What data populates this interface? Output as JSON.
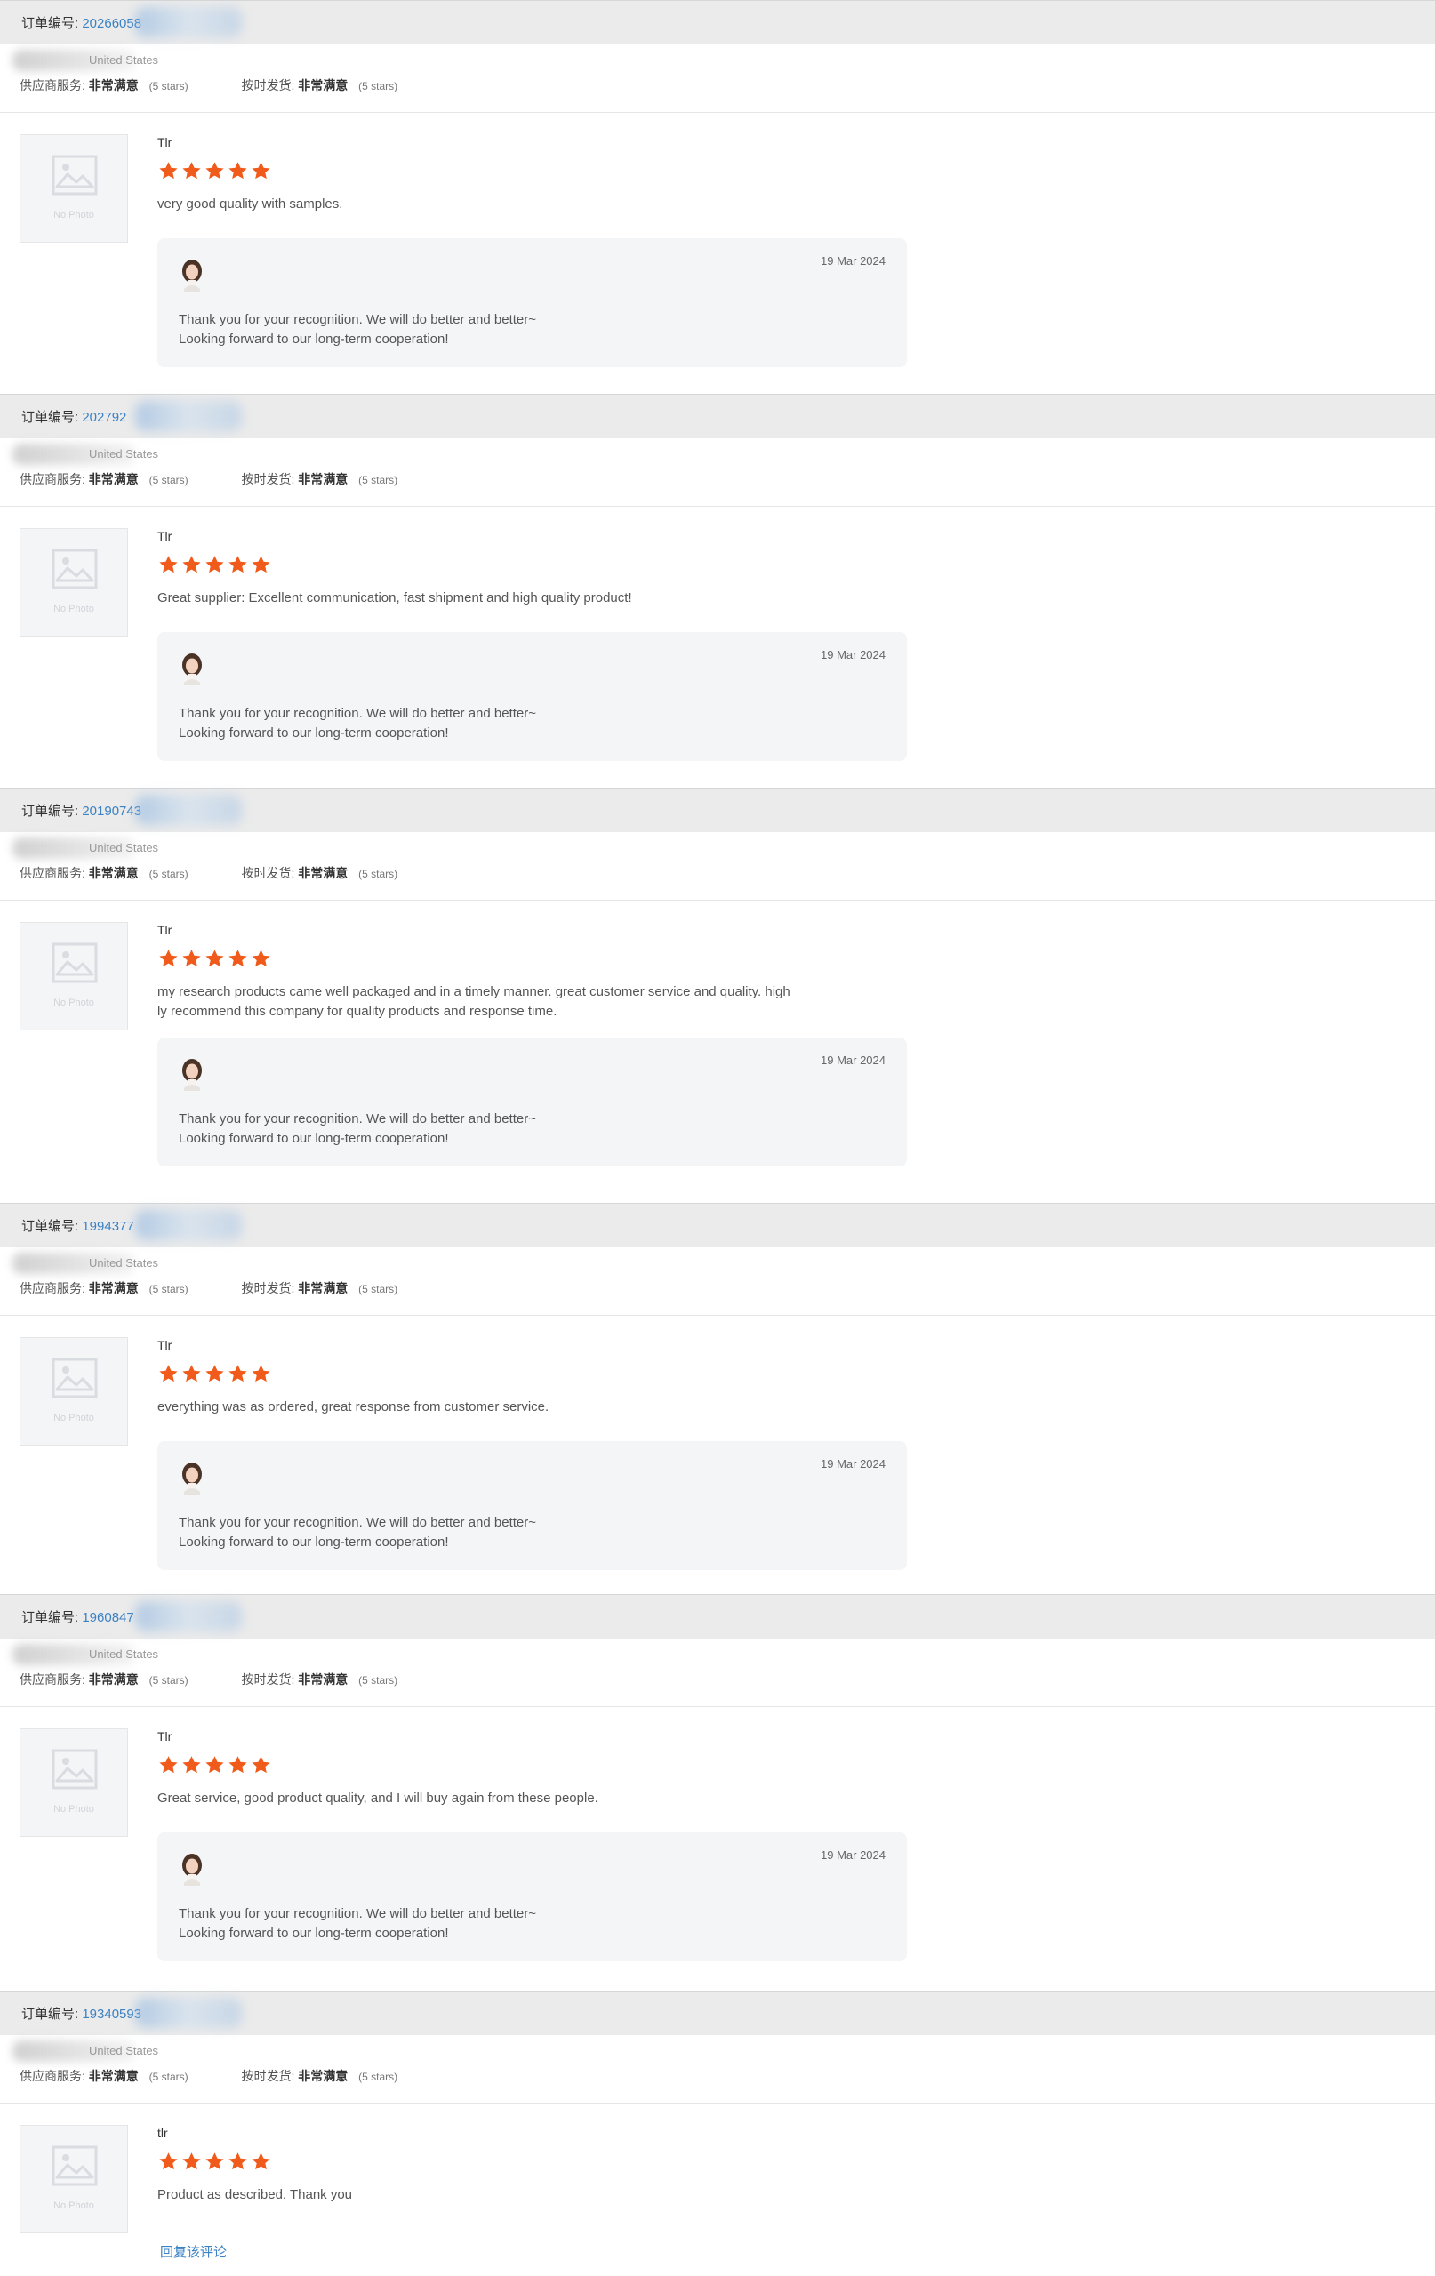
{
  "reviews": [
    {
      "order_label": "订单编号:",
      "order_number": "20266058",
      "country": "United States",
      "supplier_service_label": "供应商服务:",
      "supplier_service_value": "非常满意",
      "supplier_service_stars": "(5 stars)",
      "ontime_label": "按时发货:",
      "ontime_value": "非常满意",
      "ontime_stars": "(5 stars)",
      "thumb_text": "No Photo",
      "author": "Tlr",
      "rating": 5,
      "review": "very good quality with samples.",
      "reply_date": "19 Mar 2024",
      "reply": "Thank you for your recognition. We will do better and better~\nLooking forward to our long-term cooperation!"
    },
    {
      "order_label": "订单编号:",
      "order_number": "202792",
      "country": "United States",
      "supplier_service_label": "供应商服务:",
      "supplier_service_value": "非常满意",
      "supplier_service_stars": "(5 stars)",
      "ontime_label": "按时发货:",
      "ontime_value": "非常满意",
      "ontime_stars": "(5 stars)",
      "thumb_text": "No Photo",
      "author": "Tlr",
      "rating": 5,
      "review": "Great supplier: Excellent communication, fast shipment and high quality product!",
      "reply_date": "19 Mar 2024",
      "reply": "Thank you for your recognition. We will do better and better~\nLooking forward to our long-term cooperation!"
    },
    {
      "order_label": "订单编号:",
      "order_number": "20190743",
      "country": "United States",
      "supplier_service_label": "供应商服务:",
      "supplier_service_value": "非常满意",
      "supplier_service_stars": "(5 stars)",
      "ontime_label": "按时发货:",
      "ontime_value": "非常满意",
      "ontime_stars": "(5 stars)",
      "thumb_text": "No Photo",
      "author": "Tlr",
      "rating": 5,
      "review": "my research products came well packaged and in a timely manner. great customer service and quality. high\nly recommend this company for quality products and response time.",
      "reply_date": "19 Mar 2024",
      "reply": "Thank you for your recognition. We will do better and better~\nLooking forward to our long-term cooperation!"
    },
    {
      "order_label": "订单编号:",
      "order_number": "1994377",
      "country": "United States",
      "supplier_service_label": "供应商服务:",
      "supplier_service_value": "非常满意",
      "supplier_service_stars": "(5 stars)",
      "ontime_label": "按时发货:",
      "ontime_value": "非常满意",
      "ontime_stars": "(5 stars)",
      "thumb_text": "No Photo",
      "author": "Tlr",
      "rating": 5,
      "review": "everything was as ordered, great response from customer service.",
      "reply_date": "19 Mar 2024",
      "reply": "Thank you for your recognition. We will do better and better~\nLooking forward to our long-term cooperation!"
    },
    {
      "order_label": "订单编号:",
      "order_number": "1960847",
      "country": "United States",
      "supplier_service_label": "供应商服务:",
      "supplier_service_value": "非常满意",
      "supplier_service_stars": "(5 stars)",
      "ontime_label": "按时发货:",
      "ontime_value": "非常满意",
      "ontime_stars": "(5 stars)",
      "thumb_text": "No Photo",
      "author": "Tlr",
      "rating": 5,
      "review": "Great service, good product quality, and I will buy again from these people.",
      "reply_date": "19 Mar 2024",
      "reply": "Thank you for your recognition. We will do better and better~\nLooking forward to our long-term cooperation!"
    },
    {
      "order_label": "订单编号:",
      "order_number": "19340593",
      "country": "United States",
      "supplier_service_label": "供应商服务:",
      "supplier_service_value": "非常满意",
      "supplier_service_stars": "(5 stars)",
      "ontime_label": "按时发货:",
      "ontime_value": "非常满意",
      "ontime_stars": "(5 stars)",
      "thumb_text": "No Photo",
      "author": "tlr",
      "rating": 5,
      "review": "Product as described.  Thank you"
    }
  ],
  "reply_link_label": "回复该评论",
  "colors": {
    "accent": "#3b82c4",
    "star": "#f05a1a",
    "header_bar": "#ebebeb",
    "reply_box": "#f4f5f7"
  },
  "icons": {
    "star": "star-icon",
    "photo": "image-placeholder-icon",
    "avatar": "avatar-icon"
  }
}
